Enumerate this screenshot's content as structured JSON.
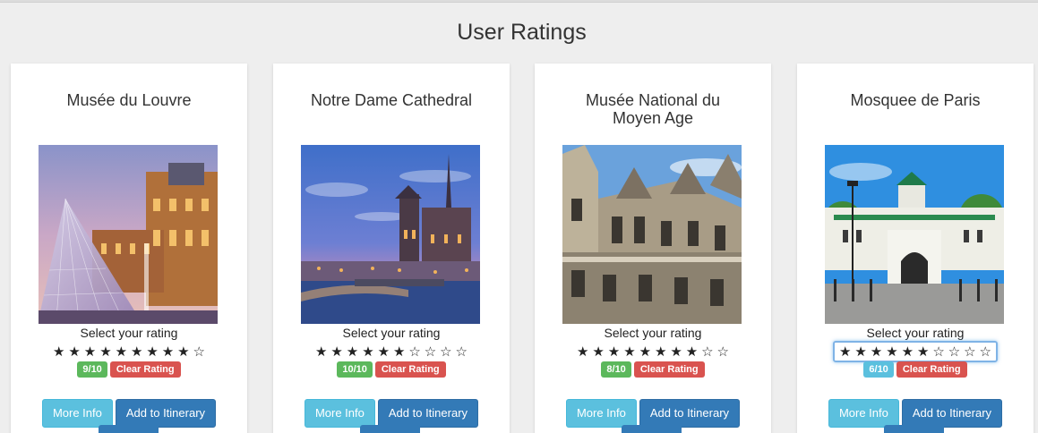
{
  "page": {
    "title": "User Ratings"
  },
  "common": {
    "select_label": "Select your rating",
    "clear_label": "Clear Rating",
    "more_info_label": "More Info",
    "add_itinerary_label": "Add to Itinerary",
    "star_filled": "★",
    "star_empty": "☆"
  },
  "colors": {
    "badge_green": "#5cb85c",
    "badge_blue": "#5bc0de",
    "clear_red": "#d9534f",
    "primary": "#337ab7",
    "info": "#5bc0de"
  },
  "cards": [
    {
      "title": "Musée du Louvre",
      "rating": 9,
      "max": 10,
      "badge": "9/10",
      "badge_color": "green",
      "focused": false
    },
    {
      "title": "Notre Dame Cathedral",
      "rating": 6,
      "max": 10,
      "badge": "10/10",
      "badge_color": "green",
      "focused": false
    },
    {
      "title": "Musée National du Moyen Age",
      "rating": 8,
      "max": 10,
      "badge": "8/10",
      "badge_color": "green",
      "focused": false
    },
    {
      "title": "Mosquee de Paris",
      "rating": 6,
      "max": 10,
      "badge": "6/10",
      "badge_color": "blue",
      "focused": true
    }
  ]
}
